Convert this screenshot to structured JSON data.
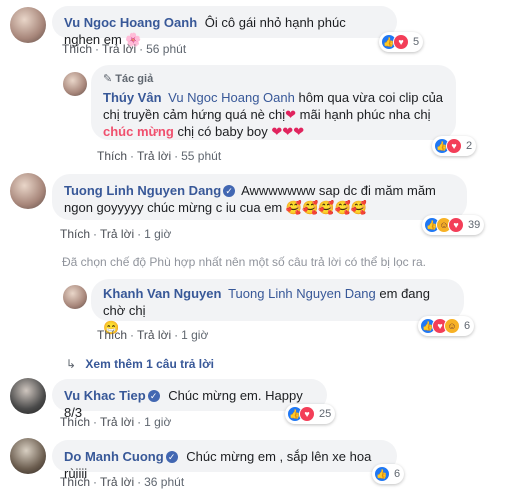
{
  "common": {
    "like": "Thích",
    "reply": "Trả lời"
  },
  "comments": [
    {
      "name": "Vu Ngoc Hoang Oanh",
      "text": "Ôi cô gái nhỏ hạnh phúc nghen em 🌸",
      "time": "56 phút",
      "reactions": 5,
      "replies": [
        {
          "author_tag": "Tác giả",
          "name": "Thúy Vân",
          "mention": "Vu Ngoc Hoang Oanh",
          "text_1": "hôm qua vừa coi clip của chị truyền cảm hứng quá nè chị",
          "text_2": "mãi hạnh phúc nha chị",
          "highlight": "chúc mừng",
          "text_3": "chị có baby boy",
          "hearts": "❤❤❤",
          "heart_inline": "❤",
          "time": "55 phút",
          "reactions": 2
        }
      ]
    },
    {
      "name": "Tuong Linh Nguyen Dang",
      "verified": true,
      "text": "Awwwwwww sap dc đi măm măm ngon goyyyyy chúc mừng c iu cua em",
      "emojis": "🥰🥰🥰🥰🥰",
      "time": "1 giờ",
      "reactions": 39,
      "filter_notice": "Đã chọn chế độ Phù hợp nhất nên một số câu trả lời có thể bị lọc ra.",
      "replies": [
        {
          "name": "Khanh Van Nguyen",
          "mention": "Tuong Linh Nguyen Dang",
          "text": "em đang chờ chị",
          "emoji": "😁",
          "time": "1 giờ",
          "reactions": 6
        }
      ],
      "more_replies": "Xem thêm 1 câu trả lời"
    },
    {
      "name": "Vu Khac Tiep",
      "verified": true,
      "text": "Chúc mừng em. Happy 8/3",
      "time": "1 giờ",
      "reactions": 25
    },
    {
      "name": "Do Manh Cuong",
      "verified": true,
      "text": "Chúc mừng em , sắp lên xe hoa rùiiii",
      "time": "36 phút",
      "reactions": 6
    }
  ],
  "icons": {
    "like": "like-icon",
    "love": "love-icon",
    "haha": "haha-icon",
    "verified": "verified-badge-icon",
    "reply_arrow": "reply-arrow-icon",
    "pencil": "pencil-icon"
  },
  "colors": {
    "name": "#385898",
    "bubble": "#f2f3f5",
    "highlight": "#f0506e",
    "meta": "#606770"
  }
}
